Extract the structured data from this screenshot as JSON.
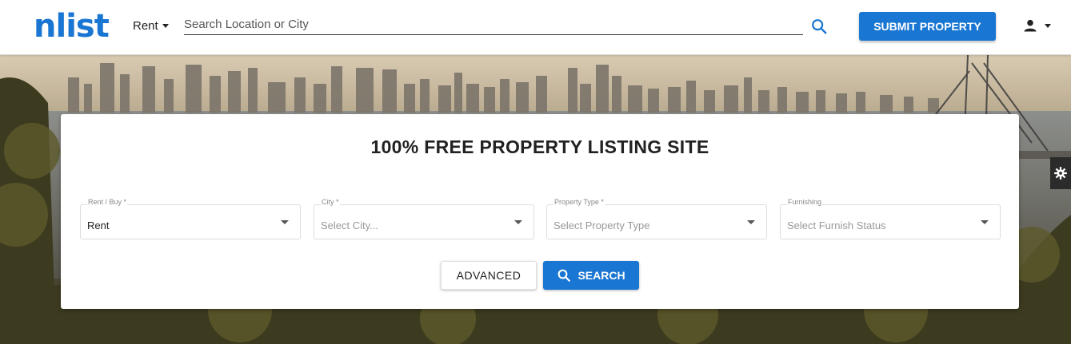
{
  "header": {
    "logo": "nlist",
    "mode_label": "Rent",
    "search_placeholder": "Search Location or City",
    "submit_label": "SUBMIT PROPERTY"
  },
  "card": {
    "title": "100% FREE PROPERTY LISTING SITE",
    "fields": [
      {
        "label": "Rent / Buy *",
        "value": "Rent"
      },
      {
        "label": "City *",
        "value": "Select City..."
      },
      {
        "label": "Property Type *",
        "value": "Select Property Type"
      },
      {
        "label": "Furnishing",
        "value": "Select Furnish Status"
      }
    ],
    "advanced_label": "ADVANCED",
    "search_label": "SEARCH"
  },
  "colors": {
    "accent": "#1976d2",
    "text": "#222222"
  },
  "icons": [
    "search-icon",
    "user-icon",
    "chevron-down-icon",
    "gear-icon"
  ]
}
